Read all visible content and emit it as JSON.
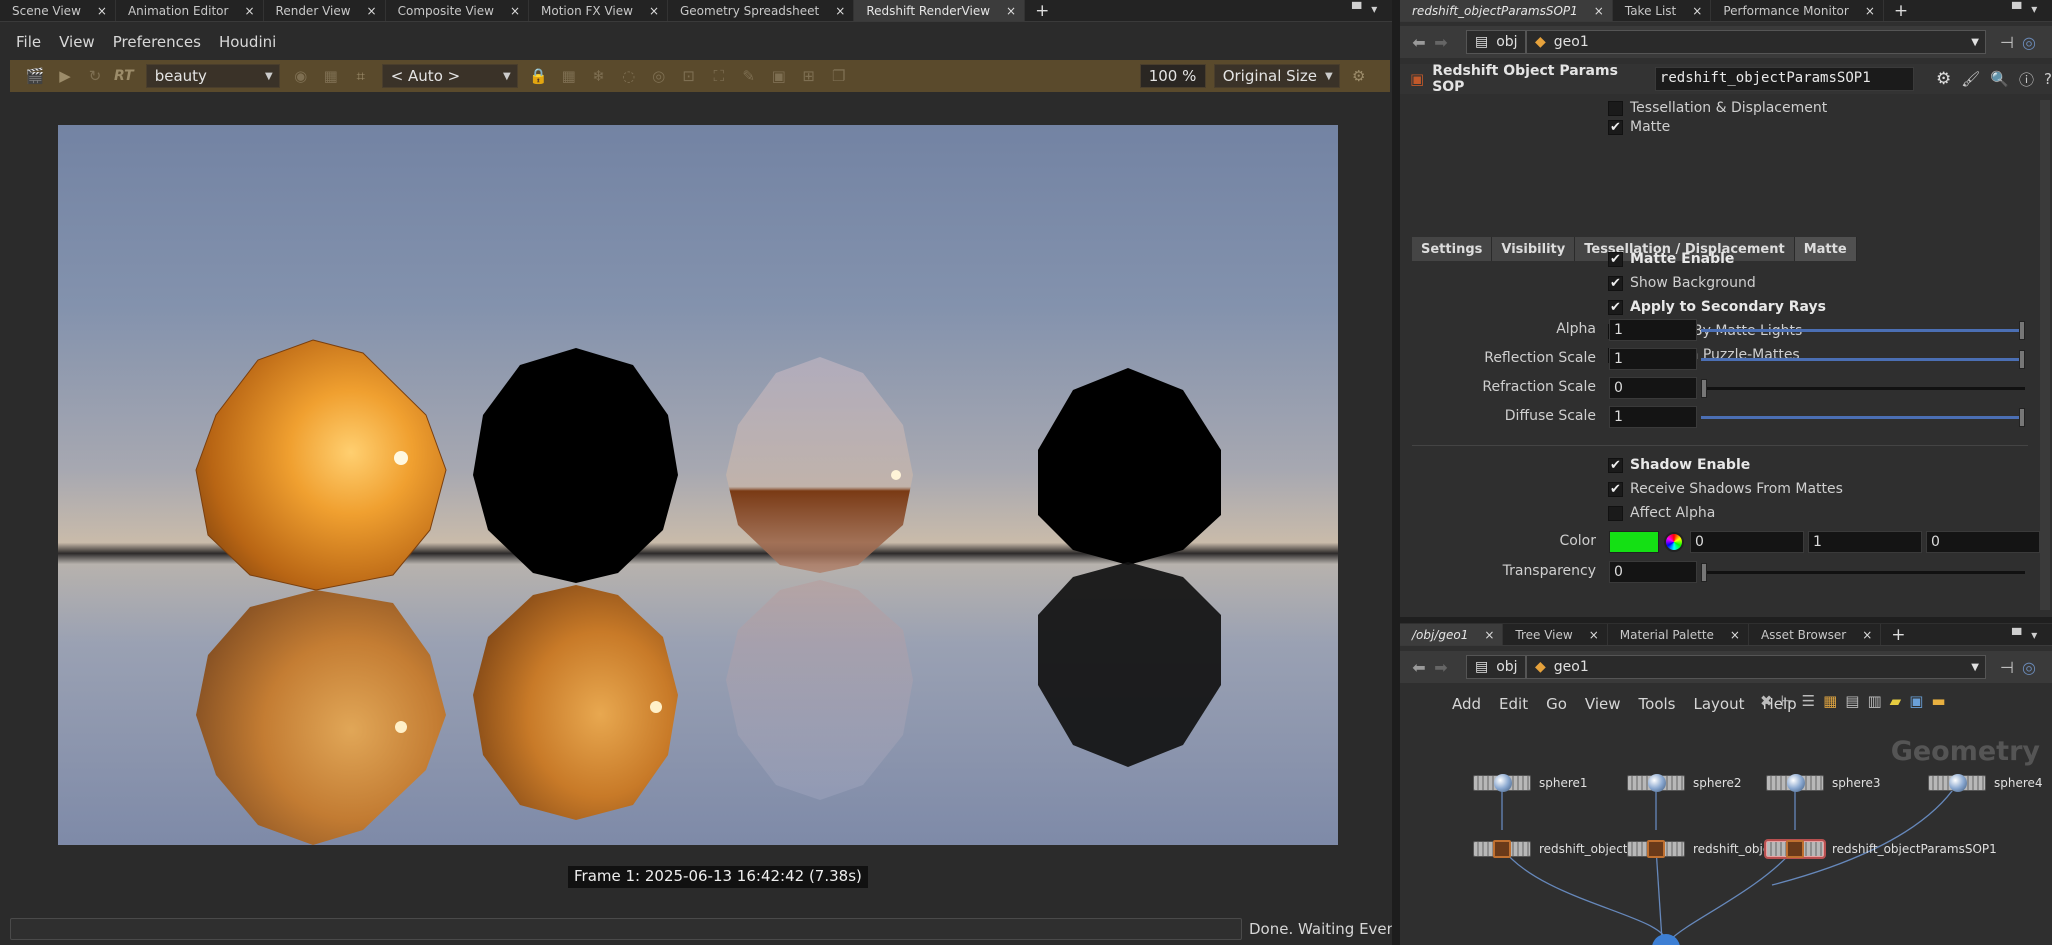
{
  "left_tabs": [
    {
      "label": "Scene View"
    },
    {
      "label": "Animation Editor"
    },
    {
      "label": "Render View"
    },
    {
      "label": "Composite View"
    },
    {
      "label": "Motion FX View"
    },
    {
      "label": "Geometry Spreadsheet"
    },
    {
      "label": "Redshift RenderView",
      "active": true
    }
  ],
  "menu": [
    "File",
    "View",
    "Preferences",
    "Houdini"
  ],
  "toolbar": {
    "rt_label": "RT",
    "aov_select": "beauty",
    "camera_select": "< Auto >",
    "zoom_value": "100 %",
    "size_select": "Original Size"
  },
  "render": {
    "frame_info": "Frame  1:  2025-06-13  16:42:42  (7.38s)",
    "status": "Done. Waiting Events"
  },
  "right_top_tabs": [
    {
      "label": "redshift_objectParamsSOP1",
      "active": true,
      "italic": true
    },
    {
      "label": "Take List"
    },
    {
      "label": "Performance Monitor"
    }
  ],
  "path": {
    "root": "obj",
    "node": "geo1"
  },
  "params_header": {
    "type": "Redshift Object Params SOP",
    "name": "redshift_objectParamsSOP1"
  },
  "toggles_top": [
    {
      "label": "Tessellation & Displacement",
      "checked": false
    },
    {
      "label": "Matte",
      "checked": true
    }
  ],
  "param_tabs": [
    "Settings",
    "Visibility",
    "Tessellation / Displacement",
    "Matte"
  ],
  "matte_toggles": [
    {
      "label": "Matte Enable",
      "checked": true,
      "bold": true
    },
    {
      "label": "Show Background",
      "checked": true
    },
    {
      "label": "Apply to Secondary Rays",
      "checked": true,
      "bold": true
    },
    {
      "label": "Affected By Matte Lights",
      "checked": false
    },
    {
      "label": "Include In Puzzle-Mattes",
      "checked": false
    }
  ],
  "sliders": [
    {
      "label": "Alpha",
      "value": "1",
      "level": 1
    },
    {
      "label": "Reflection Scale",
      "value": "1",
      "level": 1
    },
    {
      "label": "Refraction Scale",
      "value": "0",
      "level": 0
    },
    {
      "label": "Diffuse Scale",
      "value": "1",
      "level": 1
    }
  ],
  "shadow_toggles": [
    {
      "label": "Shadow Enable",
      "checked": true,
      "bold": true
    },
    {
      "label": "Receive Shadows From Mattes",
      "checked": true
    },
    {
      "label": "Affect Alpha",
      "checked": false
    }
  ],
  "color_param": {
    "label": "Color",
    "r": "0",
    "g": "1",
    "b": "0",
    "swatch": "#14e014"
  },
  "transparency": {
    "label": "Transparency",
    "value": "0",
    "level": 0
  },
  "right_bottom_tabs": [
    {
      "label": "/obj/geo1",
      "active": true,
      "italic": true
    },
    {
      "label": "Tree View"
    },
    {
      "label": "Material Palette"
    },
    {
      "label": "Asset Browser"
    }
  ],
  "network_menu": [
    "Add",
    "Edit",
    "Go",
    "View",
    "Tools",
    "Layout",
    "Help"
  ],
  "network_context": "Geometry",
  "nodes_top": [
    "sphere1",
    "sphere2",
    "sphere3",
    "sphere4"
  ],
  "nodes_bottom": [
    "redshift_objectPa",
    "redshift_obje",
    "redshift_objectParamsSOP1"
  ],
  "colors": {
    "toolbar": "#5a4a2c",
    "accent": "#4b6fb4",
    "sphere_orange": "#e08a1c"
  }
}
